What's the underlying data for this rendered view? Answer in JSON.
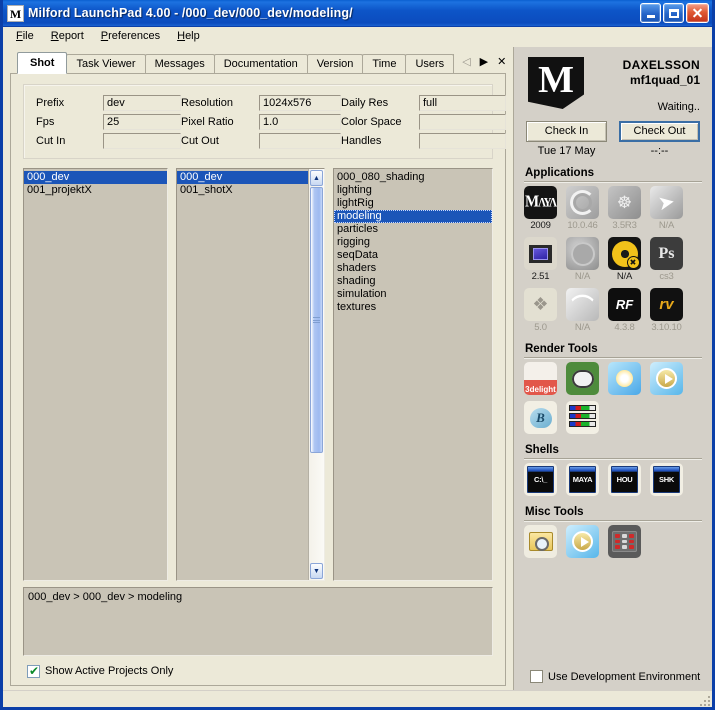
{
  "window": {
    "title": "Milford LaunchPad 4.00 - /000_dev/000_dev/modeling/",
    "icon_letter": "M",
    "minimize": "minimize-button",
    "maximize": "maximize-button",
    "close": "close-button"
  },
  "menubar": [
    {
      "label": "File",
      "accel": "F"
    },
    {
      "label": "Report",
      "accel": "R"
    },
    {
      "label": "Preferences",
      "accel": "P"
    },
    {
      "label": "Help",
      "accel": "H"
    }
  ],
  "tabs": [
    {
      "label": "Shot",
      "active": true
    },
    {
      "label": "Task Viewer",
      "active": false
    },
    {
      "label": "Messages",
      "active": false
    },
    {
      "label": "Documentation",
      "active": false
    },
    {
      "label": "Version",
      "active": false
    },
    {
      "label": "Time",
      "active": false
    },
    {
      "label": "Users",
      "active": false
    }
  ],
  "tab_nav": {
    "prev": "◁",
    "next": "▶",
    "close": "✕"
  },
  "fields": {
    "rows": [
      [
        {
          "label": "Prefix",
          "value": "dev"
        },
        {
          "label": "Resolution",
          "value": "1024x576"
        },
        {
          "label": "Daily Res",
          "value": "full"
        }
      ],
      [
        {
          "label": "Fps",
          "value": "25"
        },
        {
          "label": "Pixel Ratio",
          "value": "1.0"
        },
        {
          "label": "Color Space",
          "value": ""
        }
      ],
      [
        {
          "label": "Cut In",
          "value": ""
        },
        {
          "label": "Cut Out",
          "value": ""
        },
        {
          "label": "Handles",
          "value": ""
        }
      ]
    ]
  },
  "lists": {
    "projects": {
      "items": [
        "000_dev",
        "001_projektX"
      ],
      "selected": 0
    },
    "shots": {
      "items": [
        "000_dev",
        "001_shotX"
      ],
      "selected": 0,
      "has_scrollbar": true
    },
    "tasks": {
      "items": [
        "000_080_shading",
        "lighting",
        "lightRig",
        "modeling",
        "particles",
        "rigging",
        "seqData",
        "shaders",
        "shading",
        "simulation",
        "textures"
      ],
      "selected": 3
    }
  },
  "breadcrumb": "000_dev > 000_dev > modeling",
  "show_active_projects": {
    "label": "Show Active Projects Only",
    "checked": true
  },
  "user_panel": {
    "logo_letter": "M",
    "user": "DAXELSSON",
    "machine": "mf1quad_01",
    "status": "Waiting..",
    "check_in": {
      "label": "Check In",
      "time": "Tue 17 May"
    },
    "check_out": {
      "label": "Check Out",
      "time": "--:--"
    }
  },
  "sections": {
    "applications": {
      "title": "Applications",
      "icons": [
        {
          "name": "maya-icon",
          "caption": "2009",
          "enabled": true,
          "style": "ic-maya",
          "glyph": "Maya"
        },
        {
          "name": "houdini-icon",
          "caption": "10.0.46",
          "enabled": false,
          "style": "ic-grey ic-spiral",
          "glyph": ""
        },
        {
          "name": "xsi-runner-icon",
          "caption": "3.5R3",
          "enabled": false,
          "style": "ic-grey2 ic-runner",
          "glyph": "☸"
        },
        {
          "name": "nuke-swoosh-icon",
          "caption": "N/A",
          "enabled": false,
          "style": "ic-xsi",
          "glyph": "➤"
        },
        {
          "name": "combustion-icon",
          "caption": "2.51",
          "enabled": true,
          "style": "ic-film",
          "glyph": ""
        },
        {
          "name": "nuke-disc-grey-icon",
          "caption": "N/A",
          "enabled": false,
          "style": "ic-nukegrey",
          "glyph": ""
        },
        {
          "name": "nuke-icon",
          "caption": "N/A",
          "enabled": true,
          "style": "ic-nuke",
          "glyph": ""
        },
        {
          "name": "photoshop-icon",
          "caption": "cs3",
          "enabled": false,
          "style": "ic-ps",
          "glyph": "Ps"
        },
        {
          "name": "shake-icon",
          "caption": "5.0",
          "enabled": false,
          "style": "ic-shake",
          "glyph": "❖"
        },
        {
          "name": "swoosh-icon",
          "caption": "N/A",
          "enabled": false,
          "style": "ic-swoosh",
          "glyph": "⌒"
        },
        {
          "name": "realflow-icon",
          "caption": "4.3.8",
          "enabled": true,
          "style": "ic-rf",
          "glyph": "RF"
        },
        {
          "name": "rv-player-icon",
          "caption": "3.10.10",
          "enabled": true,
          "style": "ic-rv",
          "glyph": "rv"
        }
      ]
    },
    "render_tools": {
      "title": "Render Tools",
      "icons": [
        {
          "name": "3delight-icon",
          "caption": "",
          "style": "ic-3delight",
          "glyph": "3delight"
        },
        {
          "name": "render-cow-icon",
          "caption": "",
          "style": "ic-cow",
          "glyph": ""
        },
        {
          "name": "render-sun-icon",
          "caption": "",
          "style": "ic-sun",
          "glyph": ""
        },
        {
          "name": "render-play-icon",
          "caption": "",
          "style": "ic-play",
          "glyph": ""
        },
        {
          "name": "render-bag-icon",
          "caption": "",
          "style": "ic-bag",
          "glyph": "B"
        },
        {
          "name": "color-bars-icon",
          "caption": "",
          "style": "ic-bars",
          "glyph": ""
        }
      ]
    },
    "shells": {
      "title": "Shells",
      "icons": [
        {
          "name": "shell-cmd-icon",
          "caption": "",
          "style": "ic-term",
          "glyph": "C:\\_"
        },
        {
          "name": "shell-maya-icon",
          "caption": "",
          "style": "ic-term",
          "glyph": "MAYA"
        },
        {
          "name": "shell-houdini-icon",
          "caption": "",
          "style": "ic-term",
          "glyph": "HOU"
        },
        {
          "name": "shell-shake-icon",
          "caption": "",
          "style": "ic-term",
          "glyph": "SHK"
        }
      ]
    },
    "misc_tools": {
      "title": "Misc Tools",
      "icons": [
        {
          "name": "folder-search-icon",
          "caption": "",
          "style": "ic-folder",
          "glyph": ""
        },
        {
          "name": "media-play-icon",
          "caption": "",
          "style": "ic-play",
          "glyph": ""
        },
        {
          "name": "control-panel-icon",
          "caption": "",
          "style": "ic-panel",
          "glyph": ""
        }
      ]
    }
  },
  "use_dev_environment": {
    "label": "Use Development Environment",
    "checked": false
  },
  "colors": {
    "title_blue": "#0b4cbe",
    "face": "#ece9d8",
    "panel": "#d4d0c8",
    "list_bg": "#c9c4b6",
    "selection": "#1b55b8"
  }
}
